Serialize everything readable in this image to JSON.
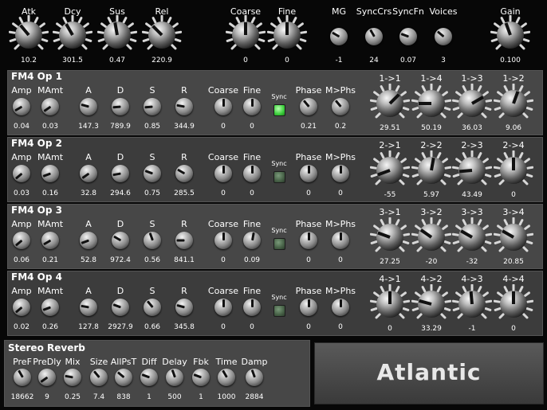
{
  "top": [
    {
      "label": "Atk",
      "value": "10.2",
      "angle": -40
    },
    {
      "label": "Dcy",
      "value": "301.5",
      "angle": -30
    },
    {
      "label": "Sus",
      "value": "0.47",
      "angle": -10
    },
    {
      "label": "Rel",
      "value": "220.9",
      "angle": -45
    },
    {
      "label": "Coarse",
      "value": "0",
      "angle": 0
    },
    {
      "label": "Fine",
      "value": "0",
      "angle": 0
    },
    {
      "label": "MG",
      "value": "-1",
      "angle": -60
    },
    {
      "label": "SyncCrs",
      "value": "24",
      "angle": -30
    },
    {
      "label": "SyncFn",
      "value": "0.07",
      "angle": -70
    },
    {
      "label": "Voices",
      "value": "3",
      "angle": -50
    },
    {
      "label": "Gain",
      "value": "0.100",
      "angle": -20
    }
  ],
  "ops": [
    {
      "title": "FM4 Op 1",
      "sync": "Sync",
      "sync_on": true,
      "knobs": [
        {
          "label": "Amp",
          "value": "0.04",
          "angle": -120
        },
        {
          "label": "MAmt",
          "value": "0.03",
          "angle": -125
        },
        {
          "label": "A",
          "value": "147.3",
          "angle": -75
        },
        {
          "label": "D",
          "value": "789.9",
          "angle": -95
        },
        {
          "label": "S",
          "value": "0.85",
          "angle": -95
        },
        {
          "label": "R",
          "value": "344.9",
          "angle": -80
        },
        {
          "label": "Coarse",
          "value": "0",
          "angle": 0
        },
        {
          "label": "Fine",
          "value": "0",
          "angle": 0
        },
        {
          "label": "Phase",
          "value": "0.21",
          "angle": -40
        },
        {
          "label": "M>Phs",
          "value": "0.2",
          "angle": -40
        }
      ],
      "mods": [
        {
          "label": "1->1",
          "value": "29.51",
          "angle": 45
        },
        {
          "label": "1->4",
          "value": "50.19",
          "angle": -90
        },
        {
          "label": "1->3",
          "value": "36.03",
          "angle": 60
        },
        {
          "label": "1->2",
          "value": "9.06",
          "angle": 20
        }
      ]
    },
    {
      "title": "FM4 Op 2",
      "sync": "Sync",
      "sync_on": false,
      "knobs": [
        {
          "label": "Amp",
          "value": "0.03",
          "angle": -130
        },
        {
          "label": "MAmt",
          "value": "0.16",
          "angle": -110
        },
        {
          "label": "A",
          "value": "32.8",
          "angle": -125
        },
        {
          "label": "D",
          "value": "294.6",
          "angle": -100
        },
        {
          "label": "S",
          "value": "0.75",
          "angle": -70
        },
        {
          "label": "R",
          "value": "285.5",
          "angle": -60
        },
        {
          "label": "Coarse",
          "value": "0",
          "angle": 0
        },
        {
          "label": "Fine",
          "value": "0",
          "angle": 0
        },
        {
          "label": "Phase",
          "value": "0",
          "angle": 0
        },
        {
          "label": "M>Phs",
          "value": "0",
          "angle": 0
        }
      ],
      "mods": [
        {
          "label": "2->1",
          "value": "-55",
          "angle": -110
        },
        {
          "label": "2->2",
          "value": "5.97",
          "angle": 10
        },
        {
          "label": "2->3",
          "value": "43.49",
          "angle": -95
        },
        {
          "label": "2->4",
          "value": "0",
          "angle": 0
        }
      ]
    },
    {
      "title": "FM4 Op 3",
      "sync": "Sync",
      "sync_on": false,
      "knobs": [
        {
          "label": "Amp",
          "value": "0.06",
          "angle": -130
        },
        {
          "label": "MAmt",
          "value": "0.21",
          "angle": -120
        },
        {
          "label": "A",
          "value": "52.8",
          "angle": -110
        },
        {
          "label": "D",
          "value": "972.4",
          "angle": -60
        },
        {
          "label": "S",
          "value": "0.56",
          "angle": -20
        },
        {
          "label": "R",
          "value": "841.1",
          "angle": -90
        },
        {
          "label": "Coarse",
          "value": "0",
          "angle": 0
        },
        {
          "label": "Fine",
          "value": "0.09",
          "angle": 10
        },
        {
          "label": "Phase",
          "value": "0",
          "angle": 0
        },
        {
          "label": "M>Phs",
          "value": "0",
          "angle": 0
        }
      ],
      "mods": [
        {
          "label": "3->1",
          "value": "27.25",
          "angle": -70
        },
        {
          "label": "3->2",
          "value": "-20",
          "angle": -55
        },
        {
          "label": "3->3",
          "value": "-32",
          "angle": -60
        },
        {
          "label": "3->4",
          "value": "20.85",
          "angle": -60
        }
      ]
    },
    {
      "title": "FM4 Op 4",
      "sync": "Sync",
      "sync_on": false,
      "knobs": [
        {
          "label": "Amp",
          "value": "0.02",
          "angle": -130
        },
        {
          "label": "MAmt",
          "value": "0.26",
          "angle": -110
        },
        {
          "label": "A",
          "value": "127.8",
          "angle": -80
        },
        {
          "label": "D",
          "value": "2927.9",
          "angle": -70
        },
        {
          "label": "S",
          "value": "0.66",
          "angle": -40
        },
        {
          "label": "R",
          "value": "345.8",
          "angle": -75
        },
        {
          "label": "Coarse",
          "value": "0",
          "angle": 0
        },
        {
          "label": "Fine",
          "value": "0",
          "angle": 0
        },
        {
          "label": "Phase",
          "value": "0",
          "angle": 0
        },
        {
          "label": "M>Phs",
          "value": "0",
          "angle": 0
        }
      ],
      "mods": [
        {
          "label": "4->1",
          "value": "0",
          "angle": 0
        },
        {
          "label": "4->2",
          "value": "33.29",
          "angle": -75
        },
        {
          "label": "4->3",
          "value": "-1",
          "angle": -5
        },
        {
          "label": "4->4",
          "value": "0",
          "angle": 0
        }
      ]
    }
  ],
  "reverb": {
    "title": "Stereo Reverb",
    "knobs": [
      {
        "label": "PreF",
        "value": "18662",
        "angle": -30
      },
      {
        "label": "PreDly",
        "value": "9",
        "angle": -125
      },
      {
        "label": "Mix",
        "value": "0.25",
        "angle": -80
      },
      {
        "label": "Size",
        "value": "7.4",
        "angle": -40
      },
      {
        "label": "AllPsT",
        "value": "838",
        "angle": -50
      },
      {
        "label": "Diff",
        "value": "1",
        "angle": -70
      },
      {
        "label": "Delay",
        "value": "500",
        "angle": -20
      },
      {
        "label": "Fbk",
        "value": "1",
        "angle": -70
      },
      {
        "label": "Time",
        "value": "1000",
        "angle": -30
      },
      {
        "label": "Damp",
        "value": "2884",
        "angle": -20
      }
    ]
  },
  "preset_name": "Atlantic"
}
